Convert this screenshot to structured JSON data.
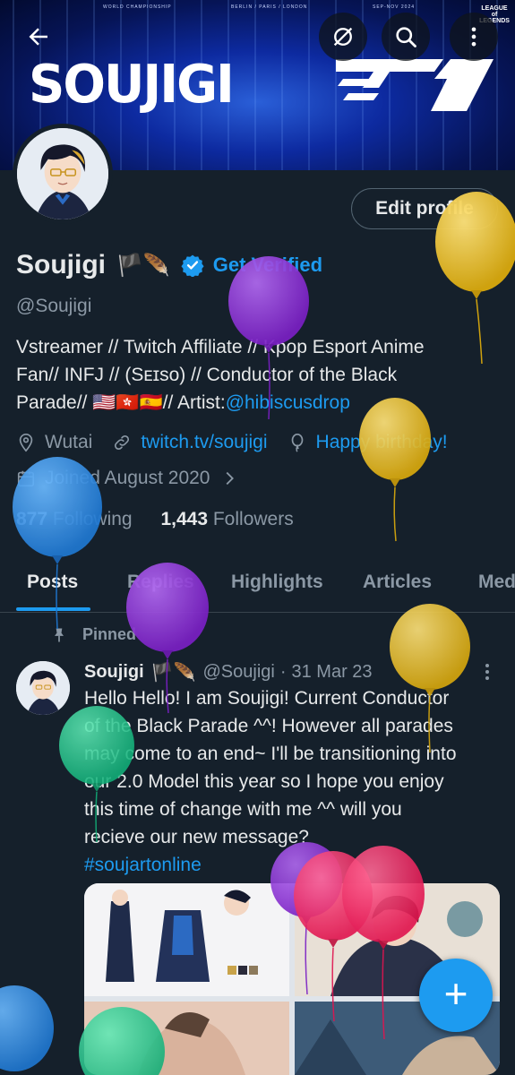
{
  "banner": {
    "brand": "SOUJIGI",
    "top_left_small": "WORLD CHAMPIONSHIP",
    "top_mid_small": "BERLIN / PARIS / LONDON",
    "top_right_small": "SEP-NOV 2024",
    "corner_logo": "LEAGUE of LEGENDS",
    "team_logo": "T1"
  },
  "topbar": {
    "back_icon": "arrow-left-icon",
    "hide_icon": "eye-slash-icon",
    "search_icon": "search-icon",
    "more_icon": "more-vertical-icon"
  },
  "profile": {
    "edit_label": "Edit profile",
    "name": "Soujigi",
    "name_emoji": "🏴🪶",
    "get_verified": "Get Verified",
    "handle": "@Soujigi",
    "bio_line1": "Vstreamer // Twitch Affiliate // Kpop Esport Anime",
    "bio_line2": "Fan// INFJ // (Sᴇɪsᴏ) // Conductor of the Black",
    "bio_line3_prefix": "Parade// 🇺🇸🇭🇰🇪🇸// Artist:",
    "bio_link": "@hibiscusdrop",
    "location": "Wutai",
    "website": "twitch.tv/soujigi",
    "birthday": "Happy birthday!",
    "joined": "Joined August 2020",
    "following_count": "877",
    "following_label": "Following",
    "followers_count": "1,443",
    "followers_label": "Followers"
  },
  "tabs": [
    "Posts",
    "Replies",
    "Highlights",
    "Articles",
    "Med"
  ],
  "tweet": {
    "pinned_label": "Pinned",
    "name": "Soujigi",
    "name_emoji": "🏴🪶",
    "handle": "@Soujigi",
    "date": "31 Mar 23",
    "line1": "Hello Hello! I am Soujigi! Current Conductor",
    "line2": "of the Black Parade ^^! However all parades",
    "line3": "may come to an end~ I'll be transitioning into",
    "line4": "our 2.0 Model this year so I hope you enjoy",
    "line5": "this time of change with me ^^ will you",
    "line6": "recieve our new message?",
    "hashtag": "#soujartonline"
  },
  "fab": {
    "label": "+"
  },
  "colors": {
    "background": "#15202b",
    "accent": "#1d9bf0",
    "text": "#e7e9ea",
    "muted": "#8b98a5",
    "balloon_yellow": "#e8b91a",
    "balloon_purple": "#8e2fd6",
    "balloon_blue": "#2f8fe3",
    "balloon_green": "#22c98a",
    "balloon_pink": "#ee2f6c"
  }
}
